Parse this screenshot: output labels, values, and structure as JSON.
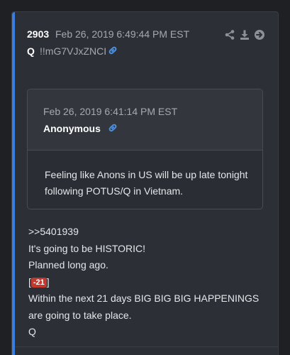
{
  "post": {
    "number": "2903",
    "date": "Feb 26, 2019 6:49:44 PM EST",
    "author": "Q",
    "tripcode": "!!mG7VJxZNCI",
    "actions": [
      "share-icon",
      "download-icon",
      "goto-arrow-icon"
    ]
  },
  "quoted": {
    "date": "Feb 26, 2019 6:41:14 PM EST",
    "author": "Anonymous",
    "body": "Feeling like Anons in US will be up late tonight following POTUS/Q in Vietnam."
  },
  "message": {
    "reply_ref": ">>5401939",
    "line1": "It's going to be HISTORIC!",
    "line2": "Planned long ago.",
    "bracket_open": "[",
    "badge": "-21",
    "bracket_close": "]",
    "line4": "Within the next 21 days BIG BIG BIG HAPPENINGS are going to take place.",
    "signature": "Q"
  },
  "colors": {
    "accent": "#3b7ddd",
    "badge": "#c23a2f",
    "link": "#4a90e2"
  }
}
